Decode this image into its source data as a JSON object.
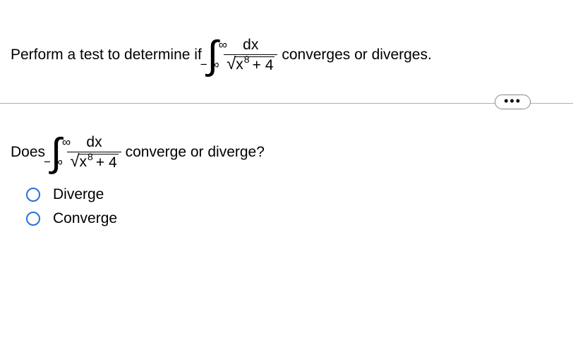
{
  "prompt": {
    "before": "Perform a test to determine if",
    "after": "converges or diverges."
  },
  "integral": {
    "upper": "∞",
    "lower": "− ∞",
    "numerator": "dx",
    "base": "x",
    "exponent": "8",
    "plus": "+ 4"
  },
  "more_button": "•••",
  "question": {
    "before": "Does",
    "after": "converge or diverge?"
  },
  "options": {
    "a": "Diverge",
    "b": "Converge"
  }
}
